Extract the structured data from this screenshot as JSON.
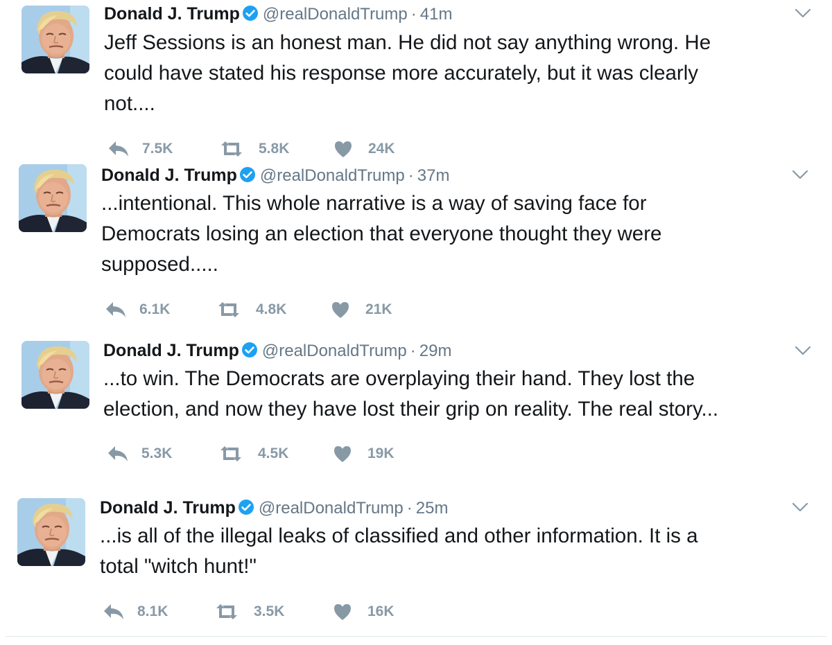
{
  "tweets": [
    {
      "author": {
        "name": "Donald J. Trump",
        "handle": "@realDonaldTrump",
        "avatar": "profile-photo",
        "verified_icon": "verified-badge-icon"
      },
      "separator": "·",
      "time": "41m",
      "text": "Jeff Sessions is an honest man. He did not say anything wrong. He\ncould have stated his response more accurately, but it was clearly\nnot....",
      "replies": "7.5K",
      "retweets": "5.8K",
      "likes": "24K"
    },
    {
      "author": {
        "name": "Donald J. Trump",
        "handle": "@realDonaldTrump",
        "avatar": "profile-photo",
        "verified_icon": "verified-badge-icon"
      },
      "separator": "·",
      "time": "37m",
      "text": "...intentional. This whole narrative is a way of saving face for\nDemocrats losing an election that everyone thought they were\nsupposed.....",
      "replies": "6.1K",
      "retweets": "4.8K",
      "likes": "21K"
    },
    {
      "author": {
        "name": "Donald J. Trump",
        "handle": "@realDonaldTrump",
        "avatar": "profile-photo",
        "verified_icon": "verified-badge-icon"
      },
      "separator": "·",
      "time": "29m",
      "text": "...to win. The Democrats are overplaying their hand. They lost the\nelection, and now they have lost their grip on reality. The real story...",
      "replies": "5.3K",
      "retweets": "4.5K",
      "likes": "19K"
    },
    {
      "author": {
        "name": "Donald J. Trump",
        "handle": "@realDonaldTrump",
        "avatar": "profile-photo",
        "verified_icon": "verified-badge-icon"
      },
      "separator": "·",
      "time": "25m",
      "text": "...is all of the illegal leaks of classified and other information. It is a\ntotal \"witch hunt!\"",
      "replies": "8.1K",
      "retweets": "3.5K",
      "likes": "16K"
    }
  ],
  "icons": {
    "reply": "reply-icon",
    "retweet": "retweet-icon",
    "like": "heart-icon",
    "more": "chevron-down-icon"
  },
  "colors": {
    "text": "#14171a",
    "secondary": "#657786",
    "action_gray": "#8899a6",
    "verified_blue": "#1da1f2",
    "divider": "#e1e8ed"
  }
}
